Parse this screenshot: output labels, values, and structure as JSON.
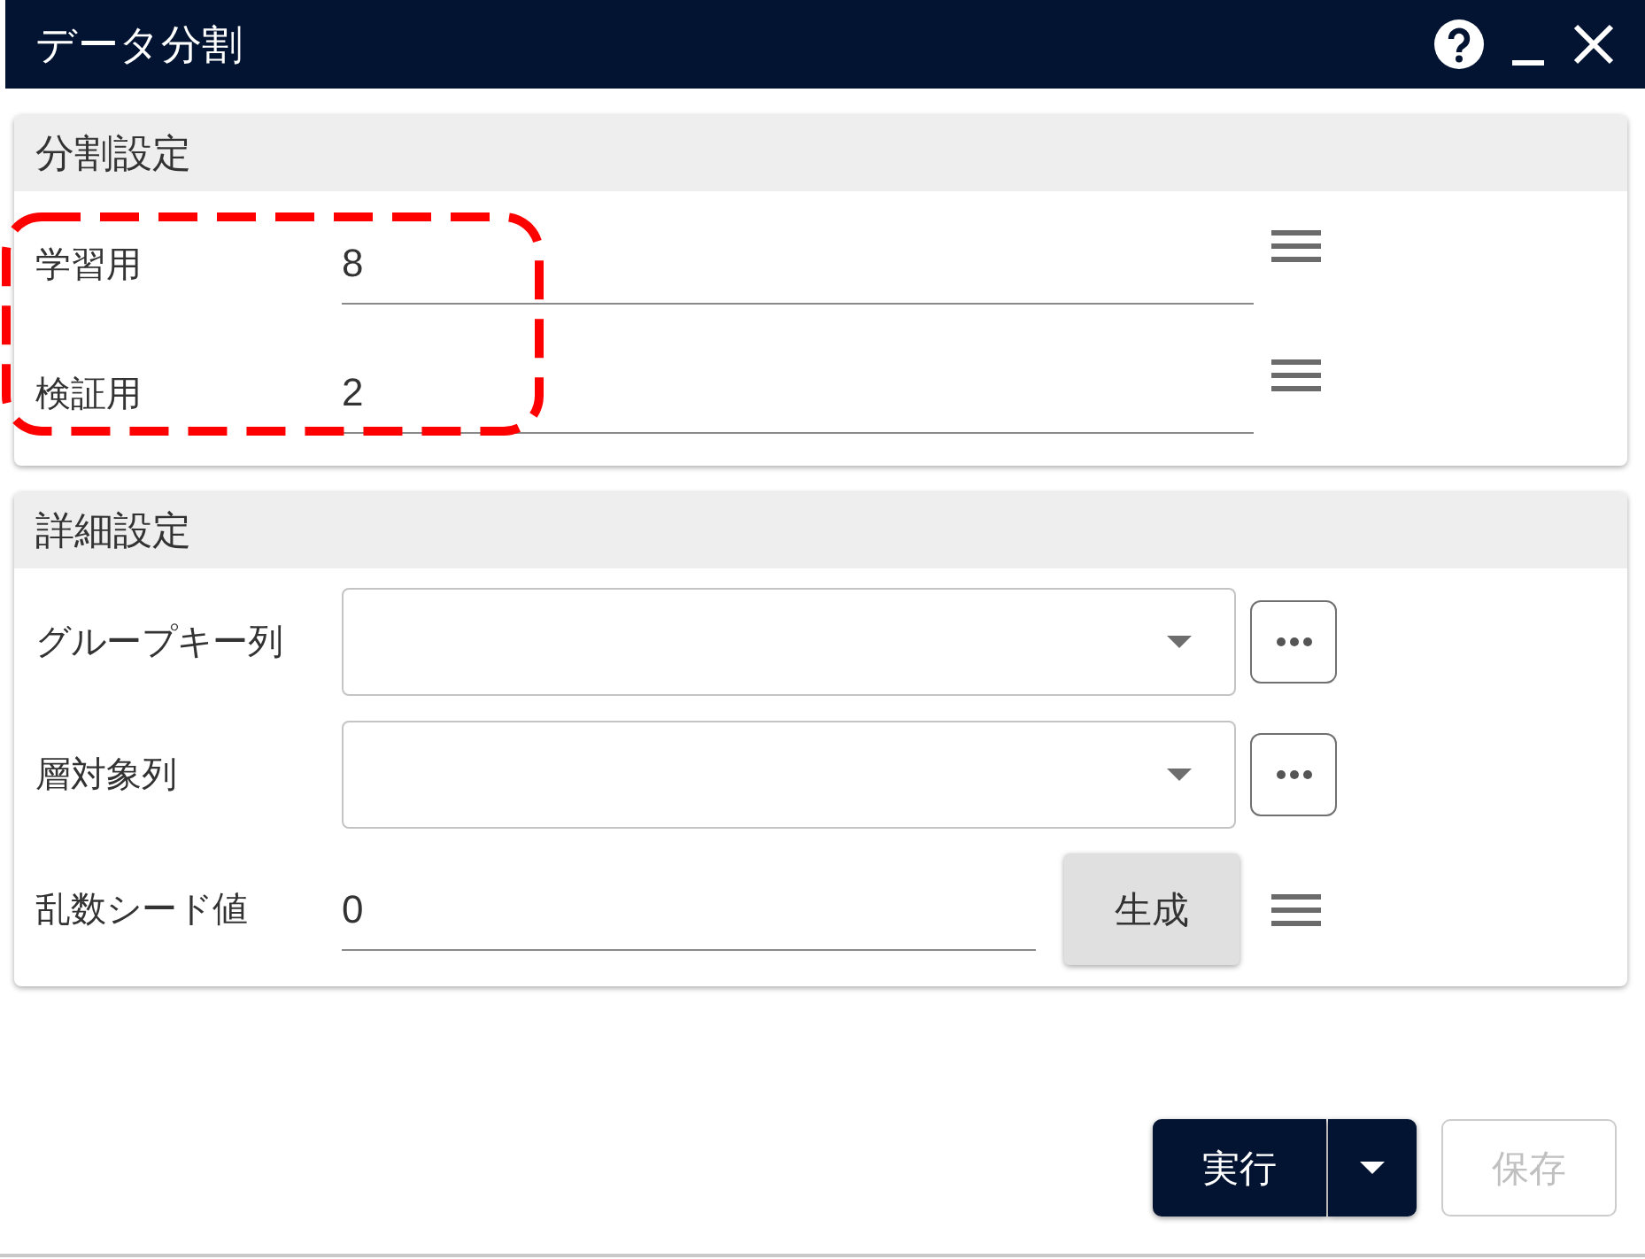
{
  "window": {
    "title": "データ分割"
  },
  "sections": [
    {
      "title": "分割設定",
      "rows": [
        {
          "kind": "text",
          "label": "学習用",
          "value": "8",
          "highlighted": true
        },
        {
          "kind": "text",
          "label": "検証用",
          "value": "2",
          "highlighted": true
        }
      ]
    },
    {
      "title": "詳細設定",
      "rows": [
        {
          "kind": "select",
          "label": "グループキー列",
          "highlighted": false
        },
        {
          "kind": "select",
          "label": "層対象列",
          "highlighted": false
        },
        {
          "kind": "seed",
          "label": "乱数シード値",
          "value": "0",
          "button": "生成",
          "highlighted": false
        }
      ]
    }
  ],
  "footer": {
    "buttons": [
      {
        "kind": "split",
        "label": "実行",
        "disabled": false
      },
      {
        "kind": "plain",
        "label": "保存",
        "disabled": true
      }
    ]
  }
}
